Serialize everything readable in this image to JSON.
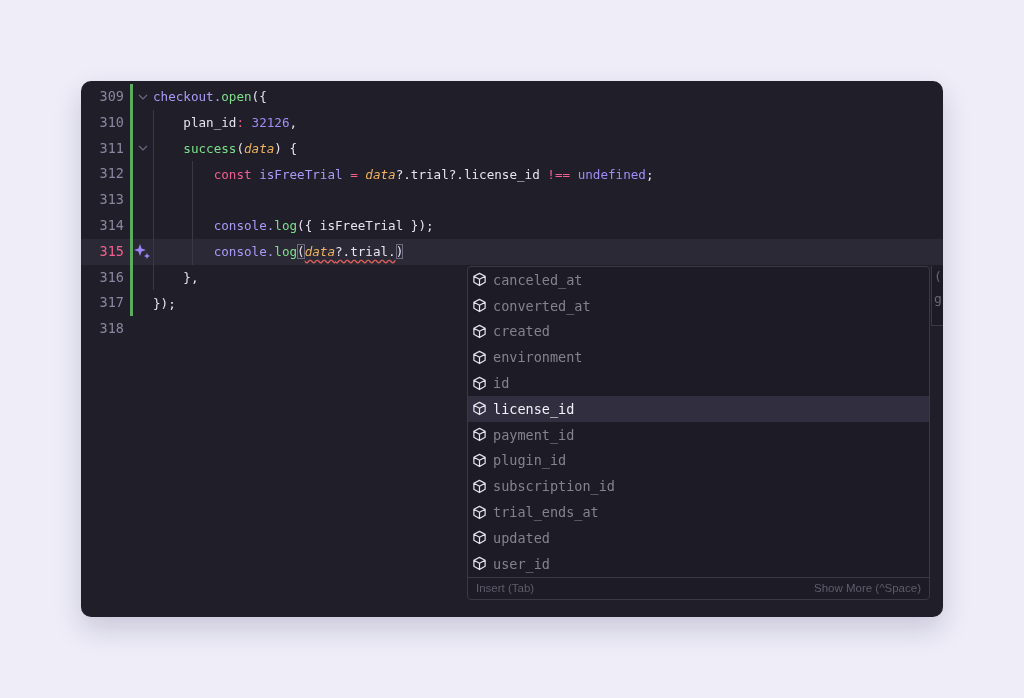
{
  "editor": {
    "lines": [
      {
        "number": "309",
        "gutter": {
          "kind": "fold"
        },
        "changed": true,
        "current": false,
        "tokens": [
          {
            "kind": "variable",
            "text": "checkout."
          },
          {
            "kind": "function",
            "text": "open"
          },
          {
            "kind": "plain",
            "text": "({"
          }
        ]
      },
      {
        "number": "310",
        "changed": true,
        "current": false,
        "tokens": [
          {
            "kind": "plain",
            "text": "    plan_id"
          },
          {
            "kind": "keyword",
            "text": ":"
          },
          {
            "kind": "number",
            "text": " 32126"
          },
          {
            "kind": "plain",
            "text": ","
          }
        ]
      },
      {
        "number": "311",
        "gutter": {
          "kind": "fold"
        },
        "changed": true,
        "current": false,
        "tokens": [
          {
            "kind": "function",
            "text": "    success"
          },
          {
            "kind": "plain",
            "text": "("
          },
          {
            "kind": "param",
            "text": "data"
          },
          {
            "kind": "plain",
            "text": ") {"
          }
        ]
      },
      {
        "number": "312",
        "changed": true,
        "current": false,
        "tokens": [
          {
            "kind": "keyword",
            "text": "        const"
          },
          {
            "kind": "variable",
            "text": " isFreeTrial"
          },
          {
            "kind": "keyword",
            "text": " = "
          },
          {
            "kind": "param",
            "text": "data"
          },
          {
            "kind": "plain",
            "text": "?.trial?.license_id "
          },
          {
            "kind": "keyword",
            "text": "!=="
          },
          {
            "kind": "number",
            "text": " undefined"
          },
          {
            "kind": "plain",
            "text": ";"
          }
        ]
      },
      {
        "number": "313",
        "changed": true,
        "current": false
      },
      {
        "number": "314",
        "changed": true,
        "current": false,
        "tokens": [
          {
            "kind": "variable",
            "text": "        console."
          },
          {
            "kind": "function",
            "text": "log"
          },
          {
            "kind": "plain",
            "text": "({ isFreeTrial });"
          }
        ]
      },
      {
        "number": "315",
        "gutter": {
          "kind": "sparkle"
        },
        "changed": true,
        "current": true,
        "tokens": [
          {
            "kind": "variable",
            "text": "        console."
          },
          {
            "kind": "function",
            "text": "log"
          },
          {
            "kind": "bracket",
            "text": "("
          },
          {
            "kind": "param",
            "text": "data",
            "error": true
          },
          {
            "kind": "plain",
            "text": "?.trial.",
            "error": true
          },
          {
            "kind": "bracket",
            "text": ")"
          }
        ]
      },
      {
        "number": "316",
        "changed": true,
        "current": false,
        "tokens": [
          {
            "kind": "plain",
            "text": "    },"
          }
        ]
      },
      {
        "number": "317",
        "changed": true,
        "current": false,
        "tokens": [
          {
            "kind": "plain",
            "text": "});"
          }
        ]
      },
      {
        "number": "318",
        "changed": false,
        "current": false
      }
    ]
  },
  "completion": {
    "items": [
      {
        "label": "canceled_at",
        "selected": false
      },
      {
        "label": "converted_at",
        "selected": false
      },
      {
        "label": "created",
        "selected": false
      },
      {
        "label": "environment",
        "selected": false
      },
      {
        "label": "id",
        "selected": false
      },
      {
        "label": "license_id",
        "selected": true
      },
      {
        "label": "payment_id",
        "selected": false
      },
      {
        "label": "plugin_id",
        "selected": false
      },
      {
        "label": "subscription_id",
        "selected": false
      },
      {
        "label": "trial_ends_at",
        "selected": false
      },
      {
        "label": "updated",
        "selected": false
      },
      {
        "label": "user_id",
        "selected": false
      }
    ],
    "insert_hint": "Insert (Tab)",
    "more_hint": "Show More (^Space)",
    "side_panel": [
      "(",
      "g"
    ]
  }
}
